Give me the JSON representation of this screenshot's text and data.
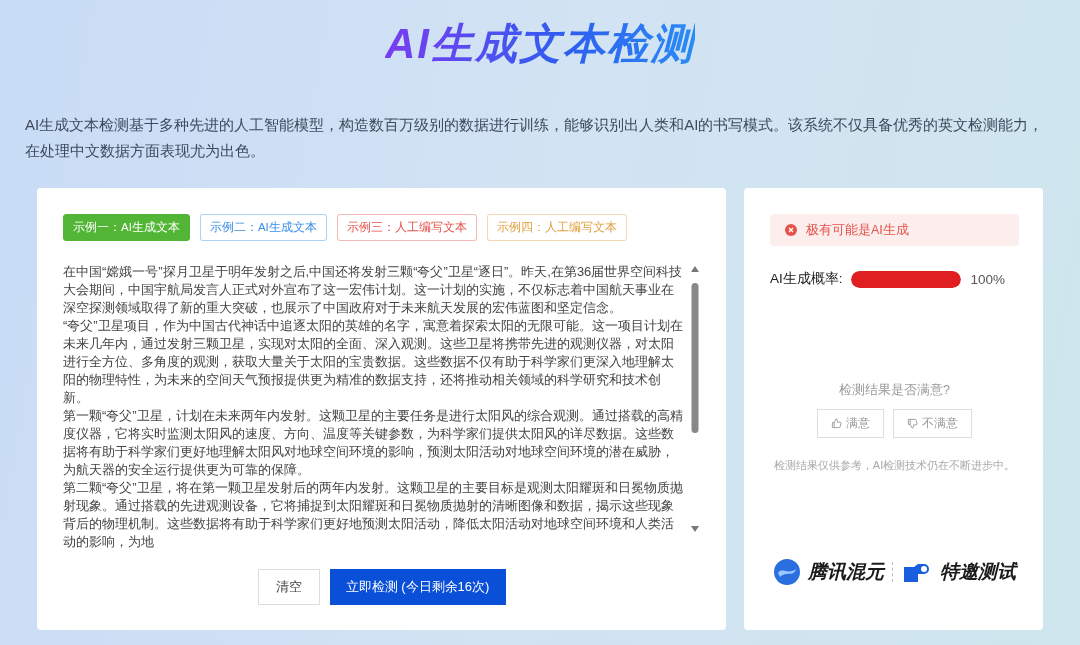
{
  "title": "AI生成文本检测",
  "description": "AI生成文本检测基于多种先进的人工智能模型，构造数百万级别的数据进行训练，能够识别出人类和AI的书写模式。该系统不仅具备优秀的英文检测能力，在处理中文数据方面表现尤为出色。",
  "examples": [
    {
      "label": "示例一：AI生成文本",
      "color": "#52b535",
      "selected": true
    },
    {
      "label": "示例二：AI生成文本",
      "color": "#3a8ee6",
      "selected": false
    },
    {
      "label": "示例三：人工编写文本",
      "color": "#e5534b",
      "selected": false
    },
    {
      "label": "示例四：人工编写文本",
      "color": "#e0a040",
      "selected": false
    }
  ],
  "input_text": [
    "在中国“嫦娥一号”探月卫星于明年发射之后,中国还将发射三颗“夸父”卫星“逐日”。昨天,在第36届世界空间科技大会期间，中国宇航局发言人正式对外宣布了这一宏伟计划。这一计划的实施，不仅标志着中国航天事业在深空探测领域取得了新的重大突破，也展示了中国政府对于未来航天发展的宏伟蓝图和坚定信念。",
    "“夸父”卫星项目，作为中国古代神话中追逐太阳的英雄的名字，寓意着探索太阳的无限可能。这一项目计划在未来几年内，通过发射三颗卫星，实现对太阳的全面、深入观测。这些卫星将携带先进的观测仪器，对太阳进行全方位、多角度的观测，获取大量关于太阳的宝贵数据。这些数据不仅有助于科学家们更深入地理解太阳的物理特性，为未来的空间天气预报提供更为精准的数据支持，还将推动相关领域的科学研究和技术创新。",
    "第一颗“夸父”卫星，计划在未来两年内发射。这颗卫星的主要任务是进行太阳风的综合观测。通过搭载的高精度仪器，它将实时监测太阳风的速度、方向、温度等关键参数，为科学家们提供太阳风的详尽数据。这些数据将有助于科学家们更好地理解太阳风对地球空间环境的影响，预测太阳活动对地球空间环境的潜在威胁，为航天器的安全运行提供更为可靠的保障。",
    "第二颗“夸父”卫星，将在第一颗卫星发射后的两年内发射。这颗卫星的主要目标是观测太阳耀斑和日冕物质抛射现象。通过搭载的先进观测设备，它将捕捉到太阳耀斑和日冕物质抛射的清晰图像和数据，揭示这些现象背后的物理机制。这些数据将有助于科学家们更好地预测太阳活动，降低太阳活动对地球空间环境和人类活动的影响，为地"
  ],
  "buttons": {
    "clear": "清空",
    "detect": "立即检测 (今日剩余16次)"
  },
  "result": {
    "verdict": "极有可能是AI生成",
    "probability_label": "AI生成概率:",
    "level": 1.0,
    "reading": "100%"
  },
  "feedback": {
    "question": "检测结果是否满意?",
    "options": [
      {
        "kind": "up",
        "label": "满意"
      },
      {
        "kind": "down",
        "label": "不满意"
      }
    ],
    "note": "检测结果仅供参考，AI检测技术仍在不断进步中。"
  },
  "logos": {
    "brand": "腾讯混元",
    "badge": "特邀测试"
  }
}
